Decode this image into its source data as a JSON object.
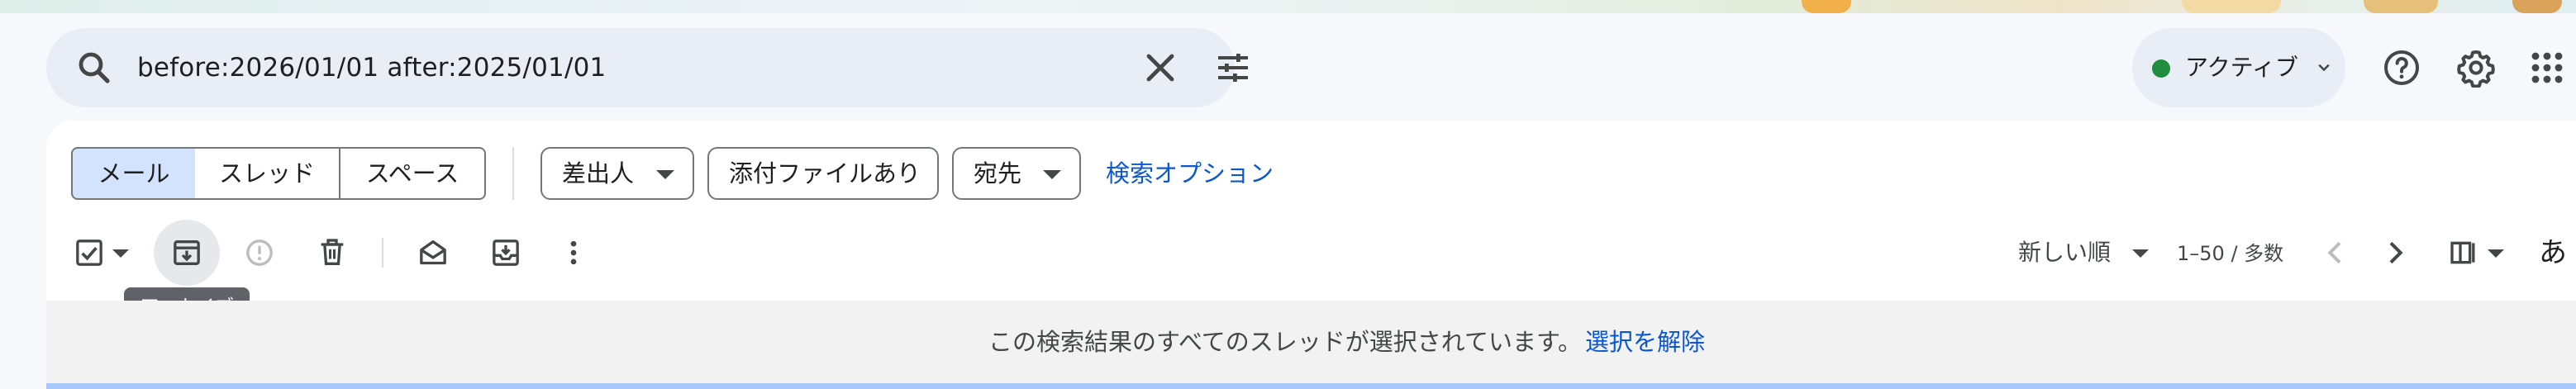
{
  "search": {
    "query": "before:2026/01/01 after:2025/01/01"
  },
  "status": {
    "label": "アクティブ",
    "dot_color": "#1e8e3e"
  },
  "header_icons": [
    "help-icon",
    "settings-icon",
    "apps-grid-icon"
  ],
  "view_tabs": [
    {
      "label": "メール",
      "selected": true
    },
    {
      "label": "スレッド",
      "selected": false
    },
    {
      "label": "スペース",
      "selected": false
    }
  ],
  "filter_chips": [
    {
      "label": "差出人",
      "dropdown": true
    },
    {
      "label": "添付ファイルあり",
      "dropdown": false
    },
    {
      "label": "宛先",
      "dropdown": true
    }
  ],
  "advanced_search_link": "検索オプション",
  "toolbar": {
    "icons": [
      "select-all-checkbox-icon",
      "archive-icon",
      "report-spam-icon",
      "delete-icon",
      "mark-as-read-icon",
      "move-to-inbox-icon",
      "more-vert-icon"
    ],
    "archive_tooltip": "アーカイブ",
    "sort_label": "新しい順",
    "page_count": "1–50 / 多数",
    "ime_indicator": "あ"
  },
  "selection_banner": {
    "message": "この検索結果のすべてのスレッドが選択されています。",
    "clear_link": "選択を解除"
  },
  "colors": {
    "accent": "#0b57d0",
    "selected_tab_bg": "#d3e3fd",
    "search_bg": "#e9eef6"
  }
}
